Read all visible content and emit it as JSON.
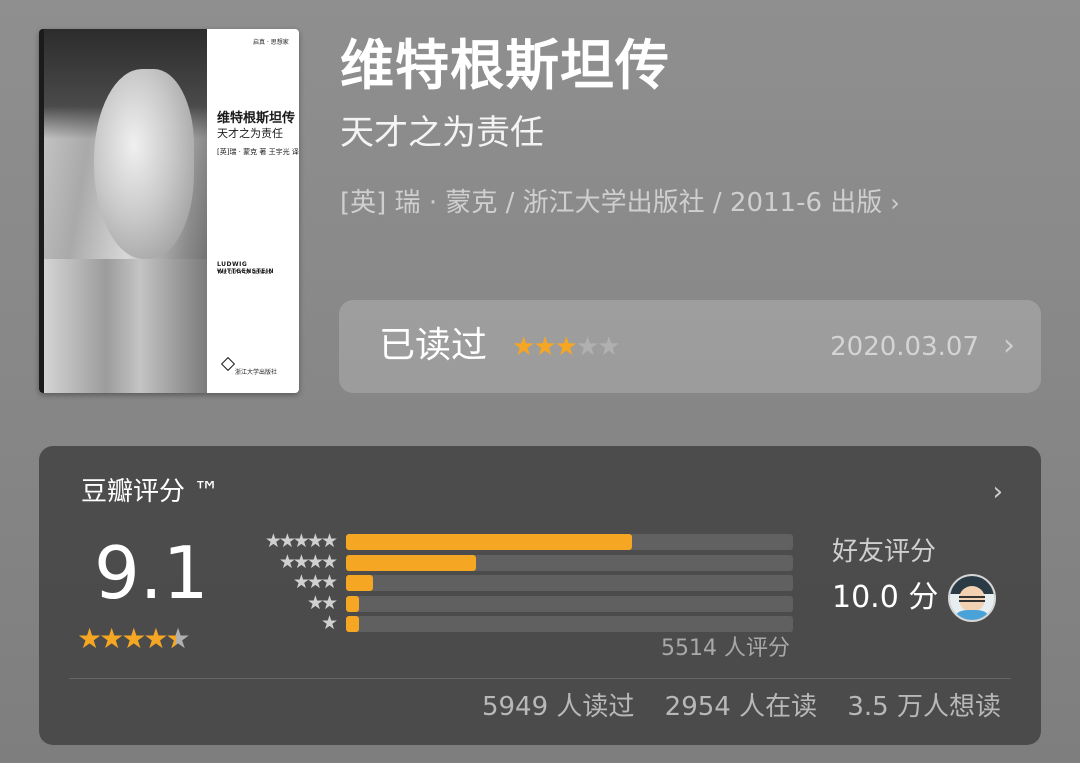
{
  "book": {
    "title": "维特根斯坦传",
    "subtitle": "天才之为责任",
    "meta": "[英] 瑞 · 蒙克 / 浙江大学出版社 / 2011-6 出版",
    "meta_chevron": "›"
  },
  "cover": {
    "title": "维特根斯坦传",
    "subtitle": "天才之为责任",
    "authors": "[英]瑞 · 蒙克 著    王宇光 译",
    "series": "启真 · 思想家",
    "en_title": "LUDWIG WITTGENSTEIN",
    "en_subtitle": "THE DUTY OF GENIUS",
    "publisher": "浙江大学出版社"
  },
  "read_status": {
    "label": "已读过",
    "my_rating": 3,
    "max_rating": 5,
    "date": "2020.03.07",
    "chevron": "›"
  },
  "rating": {
    "title": "豆瓣评分 ™",
    "chevron": "›",
    "score": "9.1",
    "stars": 4.5,
    "distribution": [
      {
        "stars": 5,
        "label": "★★★★★",
        "percent": 64
      },
      {
        "stars": 4,
        "label": "★★★★",
        "percent": 29
      },
      {
        "stars": 3,
        "label": "★★★",
        "percent": 6
      },
      {
        "stars": 2,
        "label": "★★",
        "percent": 3
      },
      {
        "stars": 1,
        "label": "★",
        "percent": 3
      }
    ],
    "count_text": "5514 人评分",
    "friend_label": "好友评分",
    "friend_score": "10.0 分",
    "stats": [
      "5949 人读过",
      "2954 人在读",
      "3.5 万人想读"
    ]
  },
  "colors": {
    "accent": "#f5a623",
    "star_off": "#b0b0b0"
  }
}
